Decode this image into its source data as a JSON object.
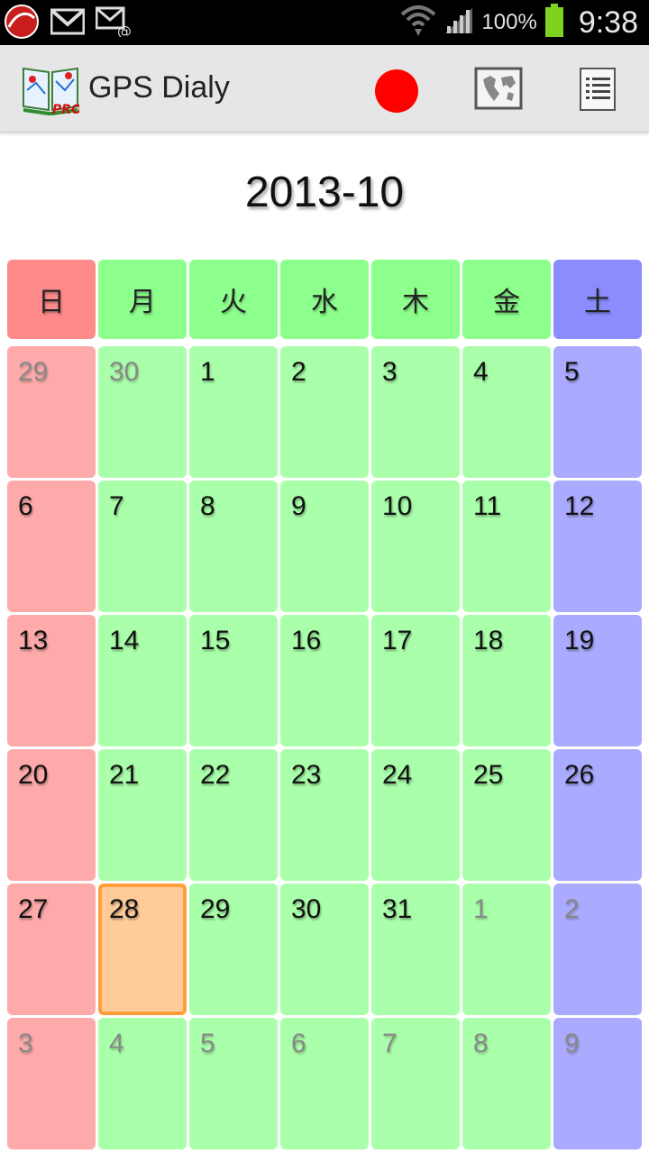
{
  "status_bar": {
    "battery_percent": "100%",
    "clock": "9:38",
    "icons": [
      "trend-micro-icon",
      "gmail-icon",
      "email-icon",
      "wifi-icon",
      "signal-icon",
      "battery-icon"
    ]
  },
  "action_bar": {
    "title": "GPS Dialy",
    "logo_badge": "PRO",
    "record_color": "#ff0000",
    "actions": [
      "record-icon",
      "map-icon",
      "list-icon"
    ]
  },
  "calendar": {
    "month_title": "2013-10",
    "weekdays": [
      "日",
      "月",
      "火",
      "水",
      "木",
      "金",
      "土"
    ],
    "weeks": [
      [
        {
          "d": "29",
          "other": true
        },
        {
          "d": "30",
          "other": true
        },
        {
          "d": "1"
        },
        {
          "d": "2"
        },
        {
          "d": "3"
        },
        {
          "d": "4"
        },
        {
          "d": "5"
        }
      ],
      [
        {
          "d": "6"
        },
        {
          "d": "7"
        },
        {
          "d": "8"
        },
        {
          "d": "9"
        },
        {
          "d": "10"
        },
        {
          "d": "11"
        },
        {
          "d": "12"
        }
      ],
      [
        {
          "d": "13"
        },
        {
          "d": "14"
        },
        {
          "d": "15"
        },
        {
          "d": "16"
        },
        {
          "d": "17"
        },
        {
          "d": "18"
        },
        {
          "d": "19"
        }
      ],
      [
        {
          "d": "20"
        },
        {
          "d": "21"
        },
        {
          "d": "22"
        },
        {
          "d": "23"
        },
        {
          "d": "24"
        },
        {
          "d": "25"
        },
        {
          "d": "26"
        }
      ],
      [
        {
          "d": "27"
        },
        {
          "d": "28",
          "today": true
        },
        {
          "d": "29"
        },
        {
          "d": "30"
        },
        {
          "d": "31"
        },
        {
          "d": "1",
          "other": true
        },
        {
          "d": "2",
          "other": true
        }
      ],
      [
        {
          "d": "3",
          "other": true
        },
        {
          "d": "4",
          "other": true
        },
        {
          "d": "5",
          "other": true
        },
        {
          "d": "6",
          "other": true
        },
        {
          "d": "7",
          "other": true
        },
        {
          "d": "8",
          "other": true
        },
        {
          "d": "9",
          "other": true
        }
      ]
    ],
    "colors": {
      "sunday": "#ffaaaa",
      "weekday": "#aaffaa",
      "saturday": "#aaaaff",
      "today": "#ffcc99",
      "today_border": "#ff9f3a"
    }
  }
}
